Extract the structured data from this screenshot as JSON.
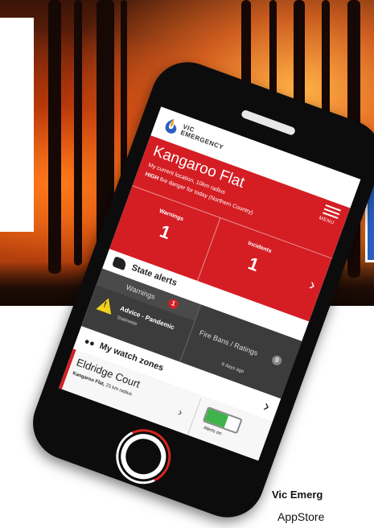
{
  "app": {
    "logo_line1": "VIC",
    "logo_line2": "EMERGENCY",
    "menu_label": "MENU"
  },
  "location": {
    "title": "Kangaroo Flat",
    "subtitle": "My current location, 10km radius",
    "danger_level": "HIGH",
    "danger_text": "fire danger for today (Northern Country)"
  },
  "stats": {
    "warnings_label": "Warnings",
    "warnings_value": "1",
    "incidents_label": "Incidents",
    "incidents_value": "1"
  },
  "state_alerts": {
    "title": "State alerts",
    "tab_warnings": "Warnings",
    "warnings_count": "1",
    "tab_fire": "Fire Bans / Ratings",
    "fire_count": "0",
    "advice_title": "Advice - Pandemic",
    "advice_sub": "Statewide",
    "advice_time": "9 days ago"
  },
  "watch": {
    "title": "My watch zones",
    "zone_title": "Eldridge Court",
    "zone_place": "Kangaroo Flat,",
    "zone_radius": "25 km radius",
    "toggle_label": "Alerts on"
  },
  "caption": {
    "line1": "Vic Emerg",
    "line2": "AppStore"
  },
  "colors": {
    "brand_red": "#d41e24",
    "toggle_green": "#3fb34a",
    "warning_yellow": "#f2d21b"
  }
}
